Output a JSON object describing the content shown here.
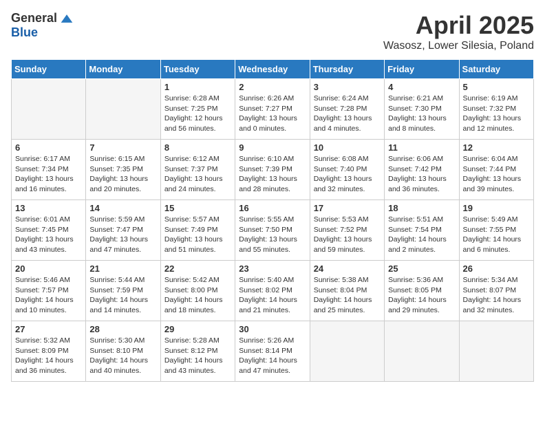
{
  "logo": {
    "general": "General",
    "blue": "Blue"
  },
  "title": {
    "month": "April 2025",
    "location": "Wasosz, Lower Silesia, Poland"
  },
  "weekdays": [
    "Sunday",
    "Monday",
    "Tuesday",
    "Wednesday",
    "Thursday",
    "Friday",
    "Saturday"
  ],
  "weeks": [
    [
      {
        "day": "",
        "detail": ""
      },
      {
        "day": "",
        "detail": ""
      },
      {
        "day": "1",
        "detail": "Sunrise: 6:28 AM\nSunset: 7:25 PM\nDaylight: 12 hours and 56 minutes."
      },
      {
        "day": "2",
        "detail": "Sunrise: 6:26 AM\nSunset: 7:27 PM\nDaylight: 13 hours and 0 minutes."
      },
      {
        "day": "3",
        "detail": "Sunrise: 6:24 AM\nSunset: 7:28 PM\nDaylight: 13 hours and 4 minutes."
      },
      {
        "day": "4",
        "detail": "Sunrise: 6:21 AM\nSunset: 7:30 PM\nDaylight: 13 hours and 8 minutes."
      },
      {
        "day": "5",
        "detail": "Sunrise: 6:19 AM\nSunset: 7:32 PM\nDaylight: 13 hours and 12 minutes."
      }
    ],
    [
      {
        "day": "6",
        "detail": "Sunrise: 6:17 AM\nSunset: 7:34 PM\nDaylight: 13 hours and 16 minutes."
      },
      {
        "day": "7",
        "detail": "Sunrise: 6:15 AM\nSunset: 7:35 PM\nDaylight: 13 hours and 20 minutes."
      },
      {
        "day": "8",
        "detail": "Sunrise: 6:12 AM\nSunset: 7:37 PM\nDaylight: 13 hours and 24 minutes."
      },
      {
        "day": "9",
        "detail": "Sunrise: 6:10 AM\nSunset: 7:39 PM\nDaylight: 13 hours and 28 minutes."
      },
      {
        "day": "10",
        "detail": "Sunrise: 6:08 AM\nSunset: 7:40 PM\nDaylight: 13 hours and 32 minutes."
      },
      {
        "day": "11",
        "detail": "Sunrise: 6:06 AM\nSunset: 7:42 PM\nDaylight: 13 hours and 36 minutes."
      },
      {
        "day": "12",
        "detail": "Sunrise: 6:04 AM\nSunset: 7:44 PM\nDaylight: 13 hours and 39 minutes."
      }
    ],
    [
      {
        "day": "13",
        "detail": "Sunrise: 6:01 AM\nSunset: 7:45 PM\nDaylight: 13 hours and 43 minutes."
      },
      {
        "day": "14",
        "detail": "Sunrise: 5:59 AM\nSunset: 7:47 PM\nDaylight: 13 hours and 47 minutes."
      },
      {
        "day": "15",
        "detail": "Sunrise: 5:57 AM\nSunset: 7:49 PM\nDaylight: 13 hours and 51 minutes."
      },
      {
        "day": "16",
        "detail": "Sunrise: 5:55 AM\nSunset: 7:50 PM\nDaylight: 13 hours and 55 minutes."
      },
      {
        "day": "17",
        "detail": "Sunrise: 5:53 AM\nSunset: 7:52 PM\nDaylight: 13 hours and 59 minutes."
      },
      {
        "day": "18",
        "detail": "Sunrise: 5:51 AM\nSunset: 7:54 PM\nDaylight: 14 hours and 2 minutes."
      },
      {
        "day": "19",
        "detail": "Sunrise: 5:49 AM\nSunset: 7:55 PM\nDaylight: 14 hours and 6 minutes."
      }
    ],
    [
      {
        "day": "20",
        "detail": "Sunrise: 5:46 AM\nSunset: 7:57 PM\nDaylight: 14 hours and 10 minutes."
      },
      {
        "day": "21",
        "detail": "Sunrise: 5:44 AM\nSunset: 7:59 PM\nDaylight: 14 hours and 14 minutes."
      },
      {
        "day": "22",
        "detail": "Sunrise: 5:42 AM\nSunset: 8:00 PM\nDaylight: 14 hours and 18 minutes."
      },
      {
        "day": "23",
        "detail": "Sunrise: 5:40 AM\nSunset: 8:02 PM\nDaylight: 14 hours and 21 minutes."
      },
      {
        "day": "24",
        "detail": "Sunrise: 5:38 AM\nSunset: 8:04 PM\nDaylight: 14 hours and 25 minutes."
      },
      {
        "day": "25",
        "detail": "Sunrise: 5:36 AM\nSunset: 8:05 PM\nDaylight: 14 hours and 29 minutes."
      },
      {
        "day": "26",
        "detail": "Sunrise: 5:34 AM\nSunset: 8:07 PM\nDaylight: 14 hours and 32 minutes."
      }
    ],
    [
      {
        "day": "27",
        "detail": "Sunrise: 5:32 AM\nSunset: 8:09 PM\nDaylight: 14 hours and 36 minutes."
      },
      {
        "day": "28",
        "detail": "Sunrise: 5:30 AM\nSunset: 8:10 PM\nDaylight: 14 hours and 40 minutes."
      },
      {
        "day": "29",
        "detail": "Sunrise: 5:28 AM\nSunset: 8:12 PM\nDaylight: 14 hours and 43 minutes."
      },
      {
        "day": "30",
        "detail": "Sunrise: 5:26 AM\nSunset: 8:14 PM\nDaylight: 14 hours and 47 minutes."
      },
      {
        "day": "",
        "detail": ""
      },
      {
        "day": "",
        "detail": ""
      },
      {
        "day": "",
        "detail": ""
      }
    ]
  ]
}
